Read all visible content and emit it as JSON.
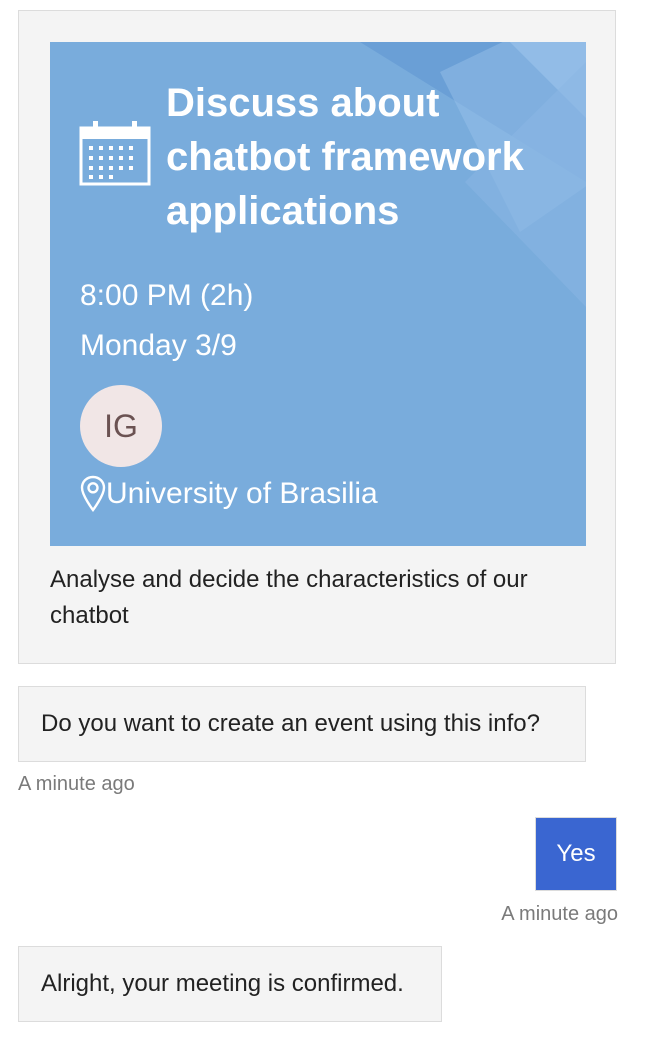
{
  "event_card": {
    "title": "Discuss about chatbot framework applications",
    "time": "8:00 PM (2h)",
    "date": "Monday 3/9",
    "attendee_initials": "IG",
    "location": "University of Brasilia",
    "description": "Analyse and decide the characteristics of our chatbot",
    "icons": [
      "calendar-icon",
      "location-pin-icon"
    ],
    "colors": {
      "hero_background": "#79acdc",
      "avatar_background": "#f1e6e6"
    }
  },
  "messages": [
    {
      "from": "bot",
      "text": "Do you want to create an event using this info?",
      "timestamp": "A minute ago"
    },
    {
      "from": "user",
      "text": "Yes",
      "timestamp": "A minute ago"
    },
    {
      "from": "bot",
      "text": "Alright, your meeting is confirmed."
    }
  ],
  "colors": {
    "user_bubble": "#3a66d1",
    "bot_bubble": "#f4f4f4"
  }
}
